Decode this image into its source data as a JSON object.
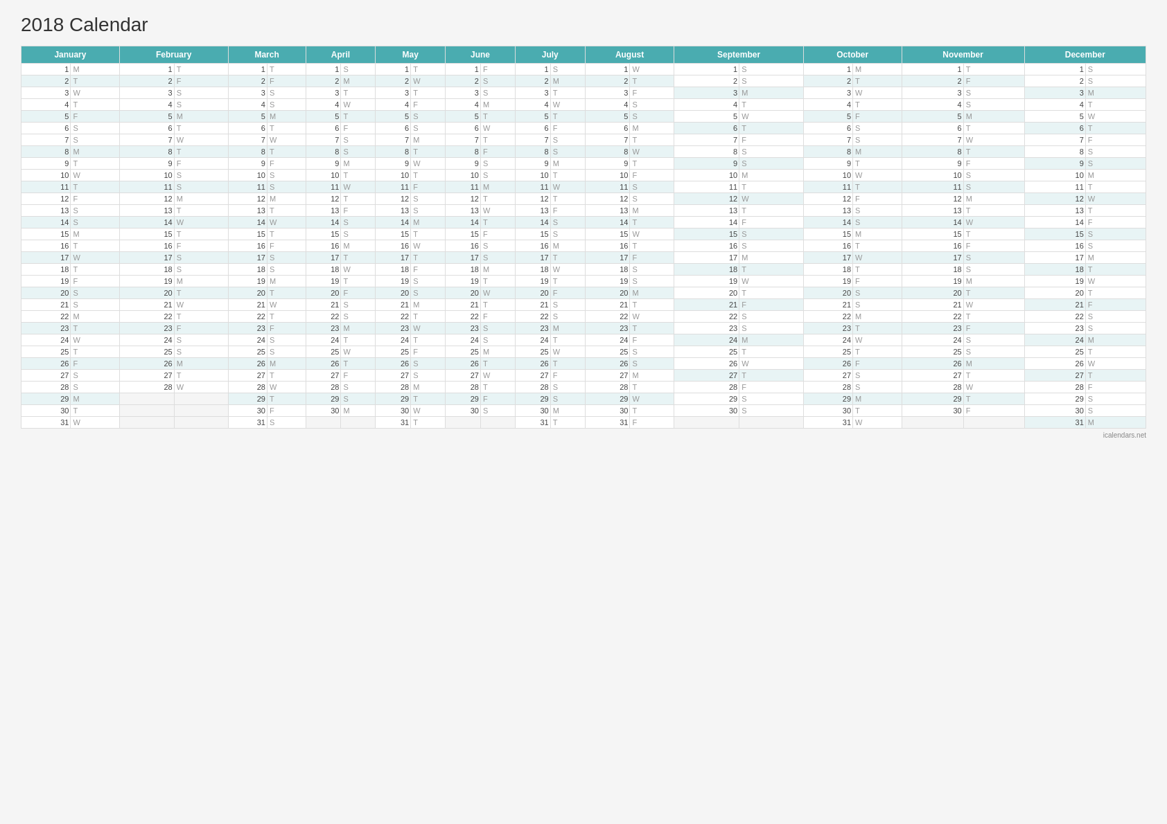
{
  "title": "2018 Calendar",
  "months": [
    "January",
    "February",
    "March",
    "April",
    "May",
    "June",
    "July",
    "August",
    "September",
    "October",
    "November",
    "December"
  ],
  "footer": "icalendars.net",
  "days": {
    "January": [
      "M",
      "T",
      "W",
      "T",
      "F",
      "S",
      "S",
      "M",
      "T",
      "W",
      "T",
      "F",
      "S",
      "S",
      "M",
      "T",
      "W",
      "T",
      "F",
      "S",
      "S",
      "M",
      "T",
      "W",
      "T",
      "F",
      "S",
      "S",
      "M",
      "T",
      "W"
    ],
    "February": [
      "T",
      "F",
      "S",
      "S",
      "M",
      "T",
      "W",
      "T",
      "F",
      "S",
      "S",
      "M",
      "T",
      "W",
      "T",
      "F",
      "S",
      "S",
      "M",
      "T",
      "W",
      "T",
      "F",
      "S",
      "S",
      "M",
      "T",
      "W",
      "",
      "",
      ""
    ],
    "March": [
      "T",
      "F",
      "S",
      "S",
      "M",
      "T",
      "W",
      "T",
      "F",
      "S",
      "S",
      "M",
      "T",
      "W",
      "T",
      "F",
      "S",
      "S",
      "M",
      "T",
      "W",
      "T",
      "F",
      "S",
      "S",
      "M",
      "T",
      "W",
      "T",
      "F",
      "S"
    ],
    "April": [
      "S",
      "M",
      "T",
      "W",
      "T",
      "F",
      "S",
      "S",
      "M",
      "T",
      "W",
      "T",
      "F",
      "S",
      "S",
      "M",
      "T",
      "W",
      "T",
      "F",
      "S",
      "S",
      "M",
      "T",
      "W",
      "T",
      "F",
      "S",
      "S",
      "M",
      ""
    ],
    "May": [
      "T",
      "W",
      "T",
      "F",
      "S",
      "S",
      "M",
      "T",
      "W",
      "T",
      "F",
      "S",
      "S",
      "M",
      "T",
      "W",
      "T",
      "F",
      "S",
      "S",
      "M",
      "T",
      "W",
      "T",
      "F",
      "S",
      "S",
      "M",
      "T",
      "W",
      "T"
    ],
    "June": [
      "F",
      "S",
      "S",
      "M",
      "T",
      "W",
      "T",
      "F",
      "S",
      "S",
      "M",
      "T",
      "W",
      "T",
      "F",
      "S",
      "S",
      "M",
      "T",
      "W",
      "T",
      "F",
      "S",
      "S",
      "M",
      "T",
      "W",
      "T",
      "F",
      "S",
      ""
    ],
    "July": [
      "S",
      "M",
      "T",
      "W",
      "T",
      "F",
      "S",
      "S",
      "M",
      "T",
      "W",
      "T",
      "F",
      "S",
      "S",
      "M",
      "T",
      "W",
      "T",
      "F",
      "S",
      "S",
      "M",
      "T",
      "W",
      "T",
      "F",
      "S",
      "S",
      "M",
      "T"
    ],
    "August": [
      "W",
      "T",
      "F",
      "S",
      "S",
      "M",
      "T",
      "W",
      "T",
      "F",
      "S",
      "S",
      "M",
      "T",
      "W",
      "T",
      "F",
      "S",
      "S",
      "M",
      "T",
      "W",
      "T",
      "F",
      "S",
      "S",
      "M",
      "T",
      "W",
      "T",
      "F"
    ],
    "September": [
      "S",
      "S",
      "M",
      "T",
      "W",
      "T",
      "F",
      "S",
      "S",
      "M",
      "T",
      "W",
      "T",
      "F",
      "S",
      "S",
      "M",
      "T",
      "W",
      "T",
      "F",
      "S",
      "S",
      "M",
      "T",
      "W",
      "T",
      "F",
      "S",
      "S",
      ""
    ],
    "October": [
      "M",
      "T",
      "W",
      "T",
      "F",
      "S",
      "S",
      "M",
      "T",
      "W",
      "T",
      "F",
      "S",
      "S",
      "M",
      "T",
      "W",
      "T",
      "F",
      "S",
      "S",
      "M",
      "T",
      "W",
      "T",
      "F",
      "S",
      "S",
      "M",
      "T",
      "W"
    ],
    "November": [
      "T",
      "F",
      "S",
      "S",
      "M",
      "T",
      "W",
      "T",
      "F",
      "S",
      "S",
      "M",
      "T",
      "W",
      "T",
      "F",
      "S",
      "S",
      "M",
      "T",
      "W",
      "T",
      "F",
      "S",
      "S",
      "M",
      "T",
      "W",
      "T",
      "F",
      ""
    ],
    "December": [
      "S",
      "S",
      "M",
      "T",
      "W",
      "T",
      "F",
      "S",
      "S",
      "M",
      "T",
      "W",
      "T",
      "F",
      "S",
      "S",
      "M",
      "T",
      "W",
      "T",
      "F",
      "S",
      "S",
      "M",
      "T",
      "W",
      "T",
      "F",
      "S",
      "S",
      "M"
    ]
  },
  "shading": {
    "January": [
      false,
      true,
      false,
      false,
      true,
      false,
      false,
      true,
      false,
      false,
      true,
      false,
      false,
      true,
      false,
      false,
      true,
      false,
      false,
      true,
      false,
      false,
      true,
      false,
      false,
      true,
      false,
      false,
      true,
      false,
      false
    ],
    "February": [
      false,
      true,
      false,
      false,
      true,
      false,
      false,
      true,
      false,
      false,
      true,
      false,
      false,
      true,
      false,
      false,
      true,
      false,
      false,
      true,
      false,
      false,
      true,
      false,
      false,
      true,
      false,
      false,
      false,
      false,
      false
    ],
    "March": [
      false,
      true,
      false,
      false,
      true,
      false,
      false,
      true,
      false,
      false,
      true,
      false,
      false,
      true,
      false,
      false,
      true,
      false,
      false,
      true,
      false,
      false,
      true,
      false,
      false,
      true,
      false,
      false,
      true,
      false,
      false
    ],
    "April": [
      false,
      true,
      false,
      false,
      true,
      false,
      false,
      true,
      false,
      false,
      true,
      false,
      false,
      true,
      false,
      false,
      true,
      false,
      false,
      true,
      false,
      false,
      true,
      false,
      false,
      true,
      false,
      false,
      true,
      false,
      false
    ],
    "May": [
      false,
      true,
      false,
      false,
      true,
      false,
      false,
      true,
      false,
      false,
      true,
      false,
      false,
      true,
      false,
      false,
      true,
      false,
      false,
      true,
      false,
      false,
      true,
      false,
      false,
      true,
      false,
      false,
      true,
      false,
      false
    ],
    "June": [
      false,
      true,
      false,
      false,
      true,
      false,
      false,
      true,
      false,
      false,
      true,
      false,
      false,
      true,
      false,
      false,
      true,
      false,
      false,
      true,
      false,
      false,
      true,
      false,
      false,
      true,
      false,
      false,
      true,
      false,
      false
    ],
    "July": [
      false,
      true,
      false,
      false,
      true,
      false,
      false,
      true,
      false,
      false,
      true,
      false,
      false,
      true,
      false,
      false,
      true,
      false,
      false,
      true,
      false,
      false,
      true,
      false,
      false,
      true,
      false,
      false,
      true,
      false,
      false
    ],
    "August": [
      false,
      true,
      false,
      false,
      true,
      false,
      false,
      true,
      false,
      false,
      true,
      false,
      false,
      true,
      false,
      false,
      true,
      false,
      false,
      true,
      false,
      false,
      true,
      false,
      false,
      true,
      false,
      false,
      true,
      false,
      false
    ],
    "September": [
      false,
      false,
      true,
      false,
      false,
      true,
      false,
      false,
      true,
      false,
      false,
      true,
      false,
      false,
      true,
      false,
      false,
      true,
      false,
      false,
      true,
      false,
      false,
      true,
      false,
      false,
      true,
      false,
      false,
      false,
      false
    ],
    "October": [
      false,
      true,
      false,
      false,
      true,
      false,
      false,
      true,
      false,
      false,
      true,
      false,
      false,
      true,
      false,
      false,
      true,
      false,
      false,
      true,
      false,
      false,
      true,
      false,
      false,
      true,
      false,
      false,
      true,
      false,
      false
    ],
    "November": [
      false,
      true,
      false,
      false,
      true,
      false,
      false,
      true,
      false,
      false,
      true,
      false,
      false,
      true,
      false,
      false,
      true,
      false,
      false,
      true,
      false,
      false,
      true,
      false,
      false,
      true,
      false,
      false,
      true,
      false,
      false
    ],
    "December": [
      false,
      false,
      true,
      false,
      false,
      true,
      false,
      false,
      true,
      false,
      false,
      true,
      false,
      false,
      true,
      false,
      false,
      true,
      false,
      false,
      true,
      false,
      false,
      true,
      false,
      false,
      true,
      false,
      false,
      false,
      true
    ]
  }
}
